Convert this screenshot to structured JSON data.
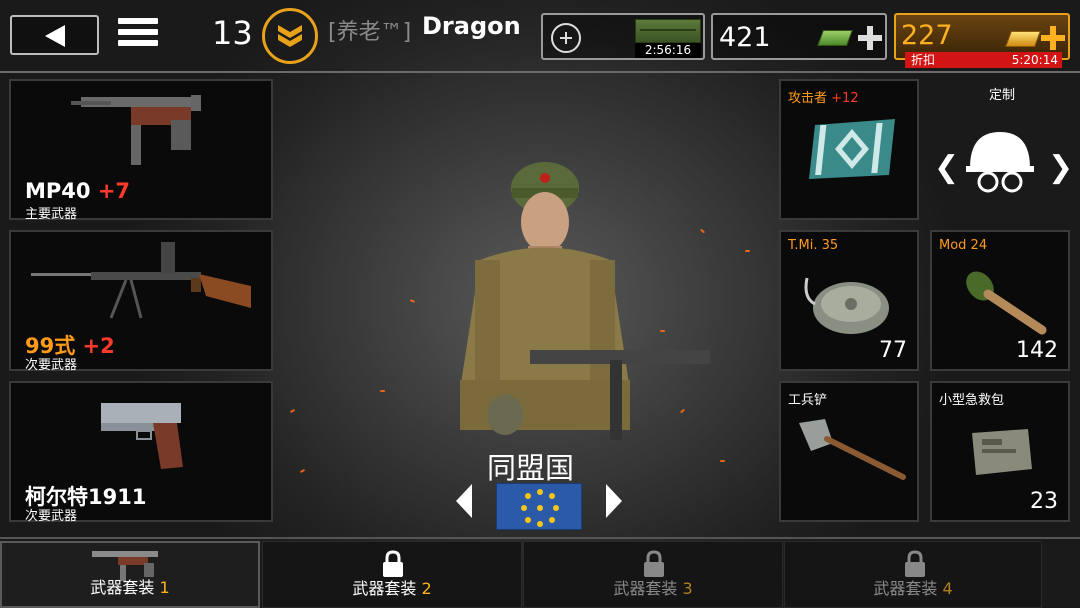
{
  "header": {
    "level": "13",
    "player_tag": "[养老™]",
    "player_name": "Dragon",
    "crate_timer": "2:56:16",
    "cash": "421",
    "gold": "227",
    "sale_label": "折扣",
    "sale_timer": "5:20:14"
  },
  "weapons": [
    {
      "name": "MP40",
      "bonus": "+7",
      "type": "主要武器"
    },
    {
      "name": "99式",
      "bonus": "+2",
      "type": "次要武器"
    },
    {
      "name": "柯尔特1911",
      "bonus": "",
      "type": "次要武器"
    }
  ],
  "equipment": {
    "medal": {
      "title": "攻击者",
      "bonus": "+12"
    },
    "custom": {
      "label": "定制"
    },
    "grenade1": {
      "title": "T.Mi. 35",
      "count": "77"
    },
    "grenade2": {
      "title": "Mod 24",
      "count": "142"
    },
    "shovel": {
      "title": "工兵铲"
    },
    "medkit": {
      "title": "小型急救包",
      "count": "23"
    }
  },
  "faction": {
    "name": "同盟国"
  },
  "loadout_tabs": [
    {
      "label": "武器套装",
      "num": "1"
    },
    {
      "label": "武器套装",
      "num": "2"
    },
    {
      "label": "武器套装",
      "num": "3"
    },
    {
      "label": "武器套装",
      "num": "4"
    }
  ],
  "colors": {
    "accent_orange": "#ff9a1a",
    "bonus_red": "#ff3a2a",
    "gold": "#ffb020",
    "sale_red": "#d21414"
  }
}
